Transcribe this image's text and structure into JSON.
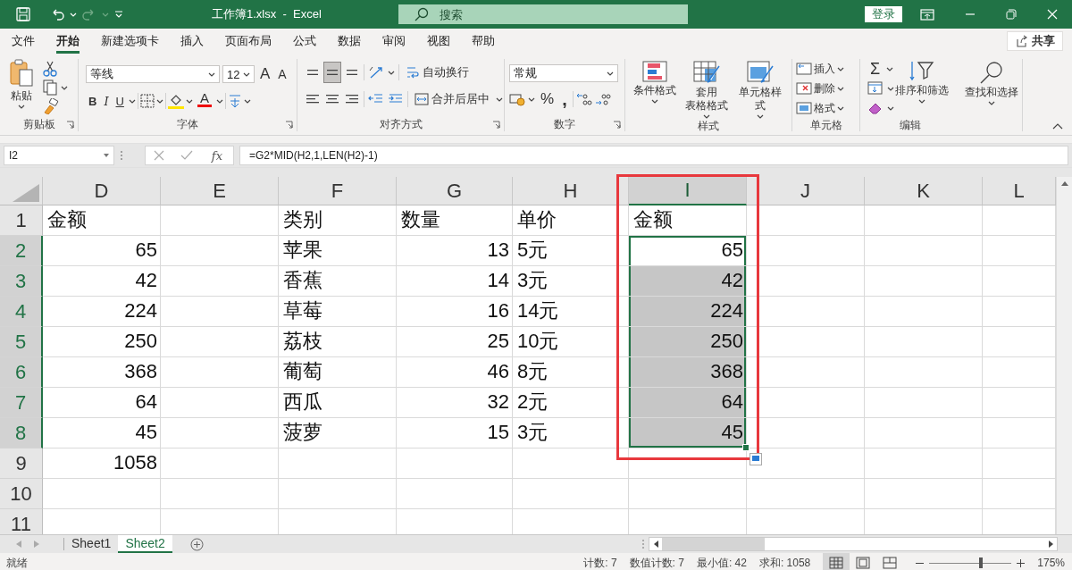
{
  "title_bar": {
    "title": "工作簿1.xlsx  -  Excel",
    "search": {
      "placeholder": "搜索"
    },
    "login": "登录"
  },
  "menu_tabs": [
    {
      "label": "文件",
      "selected": false
    },
    {
      "label": "开始",
      "selected": true
    },
    {
      "label": "新建选项卡",
      "selected": false
    },
    {
      "label": "插入",
      "selected": false
    },
    {
      "label": "页面布局",
      "selected": false
    },
    {
      "label": "公式",
      "selected": false
    },
    {
      "label": "数据",
      "selected": false
    },
    {
      "label": "审阅",
      "selected": false
    },
    {
      "label": "视图",
      "selected": false
    },
    {
      "label": "帮助",
      "selected": false
    }
  ],
  "share": "共享",
  "ribbon": {
    "clipboard": {
      "paste": "粘贴",
      "label": "剪贴板"
    },
    "font": {
      "font_name": "等线",
      "font_size": "12",
      "grow": "A",
      "shrink": "A",
      "bold": "B",
      "italic": "I",
      "underline": "U",
      "font_color": "A",
      "label": "字体"
    },
    "alignment": {
      "middle_align_selected": true,
      "wrap": "自动换行",
      "merge": "合并后居中",
      "label": "对齐方式"
    },
    "number": {
      "format": "常规",
      "percent": "%",
      "comma": ",",
      "label": "数字"
    },
    "styles": {
      "conditional": "条件格式",
      "table_lines": [
        "套用",
        "表格格式"
      ],
      "cell_styles": "单元格样式",
      "label": "样式"
    },
    "cells": {
      "insert": "插入",
      "delete": "删除",
      "format": "格式",
      "label": "单元格"
    },
    "editing": {
      "sum": "Σ",
      "sort": "排序和筛选",
      "find": "查找和选择",
      "label": "编辑"
    }
  },
  "formula_bar": {
    "name_box": "I2",
    "fx": "fx",
    "formula": "=G2*MID(H2,1,LEN(H2)-1)"
  },
  "grid": {
    "columns": [
      {
        "label": "D",
        "selected": false
      },
      {
        "label": "E",
        "selected": false
      },
      {
        "label": "F",
        "selected": false
      },
      {
        "label": "G",
        "selected": false
      },
      {
        "label": "H",
        "selected": false
      },
      {
        "label": "I",
        "selected": true
      },
      {
        "label": "J",
        "selected": false
      },
      {
        "label": "K",
        "selected": false
      },
      {
        "label": "L",
        "selected": false
      }
    ],
    "rows": [
      {
        "label": "1",
        "selected": false,
        "cells": [
          {
            "text": "金额",
            "kind": "text"
          },
          null,
          {
            "text": "类别",
            "kind": "text"
          },
          {
            "text": "数量",
            "kind": "text"
          },
          {
            "text": "单价",
            "kind": "text"
          },
          {
            "text": "金额",
            "kind": "text"
          },
          null,
          null,
          null
        ]
      },
      {
        "label": "2",
        "selected": true,
        "cells": [
          {
            "text": "65",
            "kind": "number"
          },
          null,
          {
            "text": "苹果",
            "kind": "text"
          },
          {
            "text": "13",
            "kind": "number"
          },
          {
            "text": "5元",
            "kind": "text"
          },
          {
            "text": "65",
            "kind": "number"
          },
          null,
          null,
          null
        ]
      },
      {
        "label": "3",
        "selected": true,
        "cells": [
          {
            "text": "42",
            "kind": "number"
          },
          null,
          {
            "text": "香蕉",
            "kind": "text"
          },
          {
            "text": "14",
            "kind": "number"
          },
          {
            "text": "3元",
            "kind": "text"
          },
          {
            "text": "42",
            "kind": "number"
          },
          null,
          null,
          null
        ]
      },
      {
        "label": "4",
        "selected": true,
        "cells": [
          {
            "text": "224",
            "kind": "number"
          },
          null,
          {
            "text": "草莓",
            "kind": "text"
          },
          {
            "text": "16",
            "kind": "number"
          },
          {
            "text": "14元",
            "kind": "text"
          },
          {
            "text": "224",
            "kind": "number"
          },
          null,
          null,
          null
        ]
      },
      {
        "label": "5",
        "selected": true,
        "cells": [
          {
            "text": "250",
            "kind": "number"
          },
          null,
          {
            "text": "荔枝",
            "kind": "text"
          },
          {
            "text": "25",
            "kind": "number"
          },
          {
            "text": "10元",
            "kind": "text"
          },
          {
            "text": "250",
            "kind": "number"
          },
          null,
          null,
          null
        ]
      },
      {
        "label": "6",
        "selected": true,
        "cells": [
          {
            "text": "368",
            "kind": "number"
          },
          null,
          {
            "text": "葡萄",
            "kind": "text"
          },
          {
            "text": "46",
            "kind": "number"
          },
          {
            "text": "8元",
            "kind": "text"
          },
          {
            "text": "368",
            "kind": "number"
          },
          null,
          null,
          null
        ]
      },
      {
        "label": "7",
        "selected": true,
        "cells": [
          {
            "text": "64",
            "kind": "number"
          },
          null,
          {
            "text": "西瓜",
            "kind": "text"
          },
          {
            "text": "32",
            "kind": "number"
          },
          {
            "text": "2元",
            "kind": "text"
          },
          {
            "text": "64",
            "kind": "number"
          },
          null,
          null,
          null
        ]
      },
      {
        "label": "8",
        "selected": true,
        "cells": [
          {
            "text": "45",
            "kind": "number"
          },
          null,
          {
            "text": "菠萝",
            "kind": "text"
          },
          {
            "text": "15",
            "kind": "number"
          },
          {
            "text": "3元",
            "kind": "text"
          },
          {
            "text": "45",
            "kind": "number"
          },
          null,
          null,
          null
        ]
      },
      {
        "label": "9",
        "selected": false,
        "cells": [
          {
            "text": "1058",
            "kind": "number"
          },
          null,
          null,
          null,
          null,
          null,
          null,
          null,
          null
        ]
      },
      {
        "label": "10",
        "selected": false,
        "cells": [
          null,
          null,
          null,
          null,
          null,
          null,
          null,
          null,
          null
        ]
      },
      {
        "label": "11",
        "selected": false,
        "cells": [
          null,
          null,
          null,
          null,
          null,
          null,
          null,
          null,
          null
        ]
      }
    ]
  },
  "sheet_tabs": [
    {
      "label": "Sheet1",
      "selected": false
    },
    {
      "label": "Sheet2",
      "selected": true
    }
  ],
  "status_bar": {
    "status": "就绪",
    "stats": [
      "计数: 7",
      "数值计数: 7",
      "最小值: 42",
      "求和: 1058"
    ],
    "views": [
      {
        "kind": "normal",
        "selected": true
      },
      {
        "kind": "layout",
        "selected": false
      },
      {
        "kind": "break",
        "selected": false
      }
    ],
    "zoom": {
      "level": 0.63,
      "reading": "175%"
    }
  }
}
